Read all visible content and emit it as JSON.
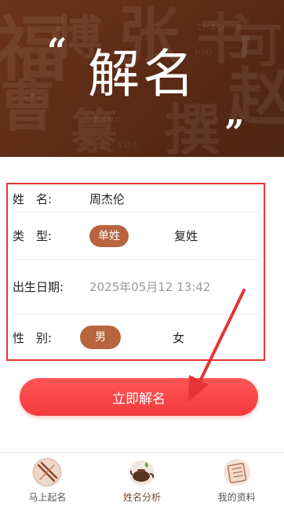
{
  "hero": {
    "title": "解名",
    "quote_open": "“",
    "quote_close": "”"
  },
  "form": {
    "name_label": "姓　名:",
    "name_value": "周杰伦",
    "type_label": "类　型:",
    "type_options": [
      "单姓",
      "复姓"
    ],
    "type_selected": "单姓",
    "birth_label": "出生日期:",
    "birth_value": "2025年05月12 13:42",
    "gender_label": "性　别:",
    "gender_options": [
      "男",
      "女"
    ],
    "gender_selected": "男"
  },
  "submit_label": "立即解名",
  "nav": {
    "items": [
      {
        "label": "马上起名",
        "icon": "chopsticks-icon"
      },
      {
        "label": "姓名分析",
        "icon": "teapot-icon"
      },
      {
        "label": "我的资料",
        "icon": "scroll-icon"
      }
    ]
  },
  "colors": {
    "hero_bg": "#5a2a15",
    "pill": "#b8643f",
    "button": "#f23b3b",
    "annotation": "#e53535"
  }
}
